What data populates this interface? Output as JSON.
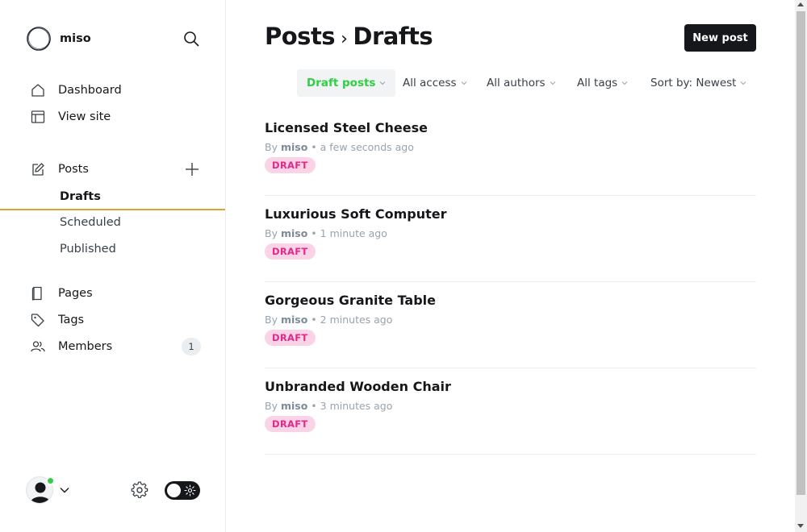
{
  "sidebar": {
    "brand_name": "miso",
    "nav_primary": [
      {
        "label": "Dashboard",
        "icon": "home-icon"
      },
      {
        "label": "View site",
        "icon": "layout-icon"
      }
    ],
    "posts": {
      "label": "Posts",
      "icon": "edit-icon",
      "sub_items": [
        {
          "label": "Drafts",
          "active": true
        },
        {
          "label": "Scheduled",
          "active": false
        },
        {
          "label": "Published",
          "active": false
        }
      ]
    },
    "nav_secondary": [
      {
        "label": "Pages",
        "icon": "page-icon"
      },
      {
        "label": "Tags",
        "icon": "tag-icon"
      },
      {
        "label": "Members",
        "icon": "members-icon",
        "count": "1"
      }
    ]
  },
  "header": {
    "breadcrumb_parent": "Posts",
    "breadcrumb_separator": "›",
    "breadcrumb_current": "Drafts",
    "new_post_label": "New post"
  },
  "filters": [
    {
      "label": "Draft posts",
      "active": true
    },
    {
      "label": "All access",
      "active": false
    },
    {
      "label": "All authors",
      "active": false
    },
    {
      "label": "All tags",
      "active": false
    },
    {
      "label": "Sort by: Newest",
      "active": false
    }
  ],
  "posts": [
    {
      "title": "Licensed Steel Cheese",
      "by": "By",
      "author": "miso",
      "time": "• a few seconds ago",
      "status": "DRAFT"
    },
    {
      "title": "Luxurious Soft Computer",
      "by": "By",
      "author": "miso",
      "time": "• 1 minute ago",
      "status": "DRAFT"
    },
    {
      "title": "Gorgeous Granite Table",
      "by": "By",
      "author": "miso",
      "time": "• 2 minutes ago",
      "status": "DRAFT"
    },
    {
      "title": "Unbranded Wooden Chair",
      "by": "By",
      "author": "miso",
      "time": "• 3 minutes ago",
      "status": "DRAFT"
    }
  ],
  "colors": {
    "accent_green": "#30cf43",
    "draft_pink_bg": "#fbd3e7",
    "draft_pink_text": "#e0298b",
    "active_underline": "#e0a12e",
    "dark": "#15171a"
  }
}
